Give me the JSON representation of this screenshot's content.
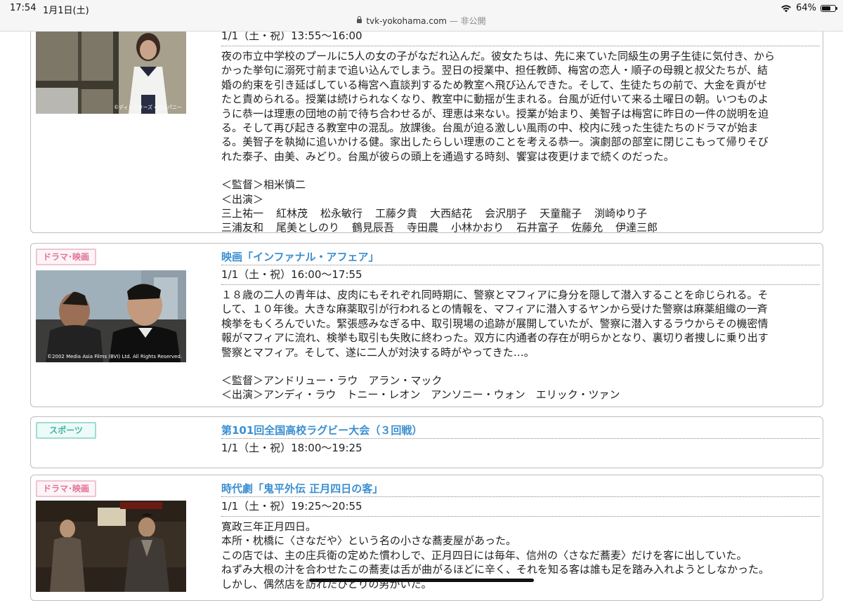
{
  "status": {
    "time": "17:54",
    "date": "1月1日(土)",
    "url": "tvk-yokohama.com",
    "url_suffix": "— 非公開",
    "battery_text": "64%",
    "battery_level": 0.64
  },
  "programs": [
    {
      "category": "",
      "title": "",
      "time": "1/1（土・祝）13:55〜16:00",
      "description_lines": [
        "夜の市立中学校のプールに5人の女の子がなだれ込んだ。彼女たちは、先に来ていた同級生の男子生徒に気付き、から",
        "かった挙句に溺死寸前まで追い込んでしまう。翌日の授業中、担任教師、梅宮の恋人・順子の母親と叔父たちが、結",
        "婚の約束を引き延ばしている梅宮へ直談判するため教室へ飛び込んできた。そして、生徒たちの前で、大金を貢がせ",
        "たと責められる。授業は続けられなくなり、教室中に動揺が生まれる。台風が近付いて来る土曜日の朝。いつものよ",
        "うに恭一は理恵の団地の前で待ち合わせるが、理恵は来ない。授業が始まり、美智子は梅宮に昨日の一件の説明を迫",
        "る。そして再び起きる教室中の混乱。放課後。台風が迫る激しい風雨の中、校内に残った生徒たちのドラマが始ま",
        "る。美智子を執拗に追いかける健。家出したらしい理恵のことを考える恭一。演劇部の部室に閉じこもって帰りそび",
        "れた泰子、由美、みどり。台風が彼らの頭上を通過する時刻、饗宴は夜更けまで続くのだった。"
      ],
      "director_label": "＜監督＞相米慎二",
      "cast_label": "＜出演＞",
      "cast_rows": [
        [
          "三上祐一",
          "紅林茂",
          "松永敏行",
          "工藤夕貴",
          "大西結花",
          "会沢朋子",
          "天童龍子",
          "渕崎ゆり子"
        ],
        [
          "三浦友和",
          "尾美としのり",
          "鶴見辰吾",
          "寺田農",
          "小林かおり",
          "石井富子",
          "佐藤允",
          "伊達三郎"
        ]
      ],
      "image_credit": "©ディレクターズ・カンパニー"
    },
    {
      "category": "ドラマ･映画",
      "title": "映画「インファナル・アフェア」",
      "time": "1/1（土・祝）16:00〜17:55",
      "description_lines": [
        "１８歳の二人の青年は、皮肉にもそれぞれ同時期に、警察とマフィアに身分を隠して潜入することを命じられる。そ",
        "して、１０年後。大きな麻薬取引が行われるとの情報を、マフィアに潜入するヤンから受けた警察は麻薬組織の一斉",
        "検挙をもくろんでいた。緊張感みなぎる中、取引現場の追跡が展開していたが、警察に潜入するラウからその機密情",
        "報がマフィアに流れ、検挙も取引も失敗に終わった。双方に内通者の存在が明らかとなり、裏切り者捜しに乗り出す",
        "警察とマフィア。そして、遂に二人が対決する時がやってきた…。"
      ],
      "director_label": "＜監督＞アンドリュー・ラウ　アラン・マック",
      "cast_label": "＜出演＞アンディ・ラウ　トニー・レオン　アンソニー・ウォン　エリック・ツァン",
      "image_credit": "©2002 Media Asia Films (BVI) Ltd. All Rights Reserved."
    },
    {
      "category": "スポーツ",
      "title": "第101回全国高校ラグビー大会（３回戦）",
      "time": "1/1（土・祝）18:00〜19:25"
    },
    {
      "category": "ドラマ･映画",
      "title": "時代劇「鬼平外伝 正月四日の客」",
      "time": "1/1（土・祝）19:25〜20:55",
      "description_lines": [
        "寛政三年正月四日。",
        "本所・枕橋に〈さなだや〉という名の小さな蕎麦屋があった。",
        "この店では、主の庄兵衛の定めた慣わしで、正月四日には毎年、信州の〈さなだ蕎麦〉だけを客に出していた。",
        "ねずみ大根の汁を合わせたこの蕎麦は舌が曲がるほどに辛く、それを知る客は誰も足を踏み入れようとしなかった。",
        "しかし、偶然店を訪れたひとりの男がいた。"
      ]
    }
  ],
  "colors": {
    "title_blue": "#3b8fd1",
    "drama_badge": "#e0729a",
    "sports_badge": "#40b3a2",
    "card_border": "#bdbdbd"
  }
}
